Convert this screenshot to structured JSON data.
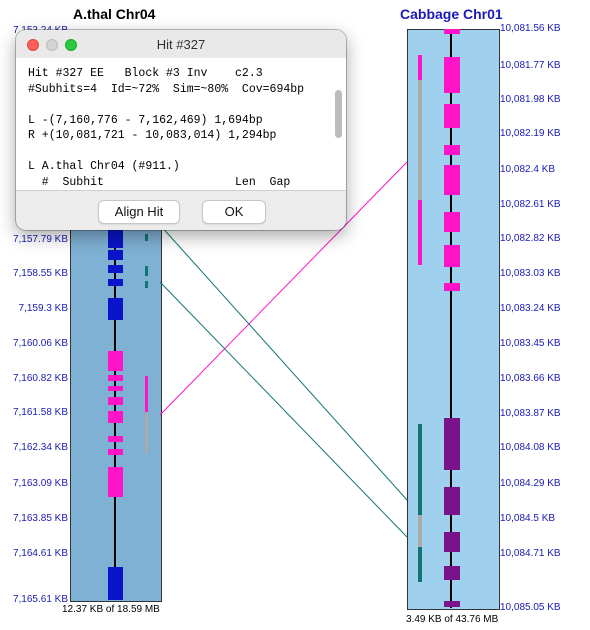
{
  "left_chr": {
    "title": "A.thal Chr04",
    "size_label": "12.37 KB of 18.59 MB",
    "ticks": [
      "7,153.24 KB",
      "7,",
      "7,",
      "7,",
      "7,",
      "7,157.79 KB",
      "7,158.55 KB",
      "7,159.3 KB",
      "7,160.06 KB",
      "7,160.82 KB",
      "7,161.58 KB",
      "7,162.34 KB",
      "7,163.09 KB",
      "7,163.85 KB",
      "7,164.61 KB",
      "7,165.61 KB"
    ]
  },
  "right_chr": {
    "title": "Cabbage Chr01",
    "size_label": "3.49 KB of 43.76 MB",
    "ticks": [
      "10,081.56 KB",
      "10,081.77 KB",
      "10,081.98 KB",
      "10,082.19 KB",
      "10,082.4 KB",
      "10,082.61 KB",
      "10,082.82 KB",
      "10,083.03 KB",
      "10,083.24 KB",
      "10,083.45 KB",
      "10,083.66 KB",
      "10,083.87 KB",
      "10,084.08 KB",
      "10,084.29 KB",
      "10,084.5 KB",
      "10,084.71 KB",
      "10,085.05 KB"
    ]
  },
  "colors": {
    "left_track": "#7fb1d4",
    "right_track": "#9fd1ef",
    "gene_blue": "#0a14c8",
    "hit_magenta": "#ff14c8",
    "hit_teal": "#127474",
    "gene_purple": "#7a128a",
    "gray_bar": "#aaaaaa",
    "axis_text": "#1a1ab8"
  },
  "dialog": {
    "title": "Hit #327",
    "lines": [
      "Hit #327 EE   Block #3 Inv    c2.3",
      "#Subhits=4  Id=~72%  Sim=~80%  Cov=694bp",
      "",
      "L -(7,160,776 - 7,162,469) 1,694bp",
      "R +(10,081,721 - 10,083,014) 1,294bp",
      "",
      "L A.thal Chr04 (#911.)",
      "  #  Subhit                   Len  Gap"
    ],
    "align_button": "Align Hit",
    "ok_button": "OK"
  }
}
